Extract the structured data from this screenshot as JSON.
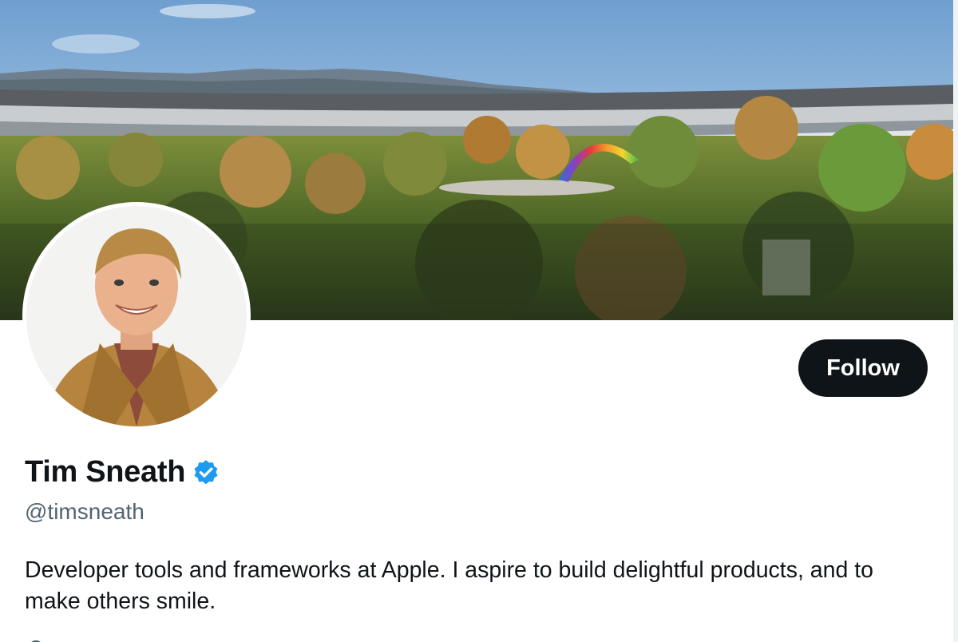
{
  "profile": {
    "banner_alt": "Apple Park campus with rainbow arch",
    "avatar_alt": "Tim Sneath avatar",
    "display_name": "Tim Sneath",
    "verified": true,
    "handle": "@timsneath",
    "bio": "Developer tools and frameworks at Apple. I aspire to build delightful products, and to make others smile."
  },
  "actions": {
    "follow_label": "Follow"
  },
  "icons": {
    "verified": "verified-badge-icon",
    "partial": "location-icon"
  },
  "colors": {
    "text_primary": "#0f1419",
    "text_secondary": "#536471",
    "verified_blue": "#1d9bf0",
    "button_bg": "#0f1419",
    "button_text": "#ffffff"
  }
}
